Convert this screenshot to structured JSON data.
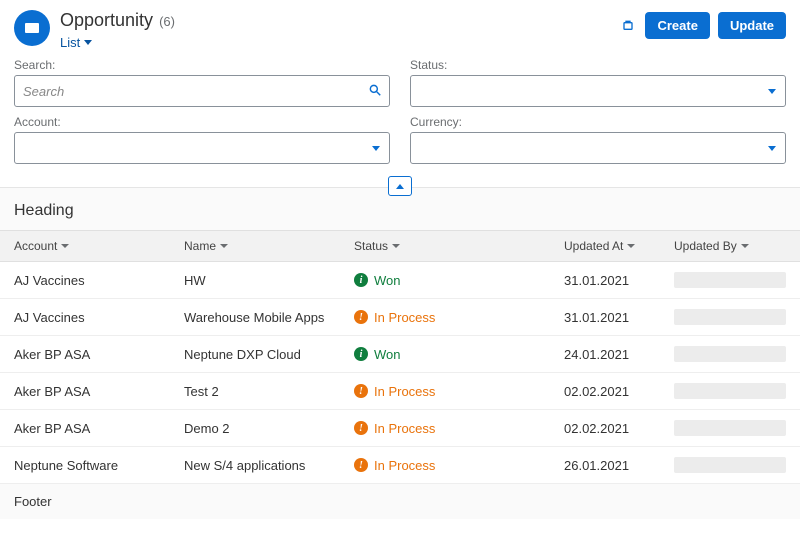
{
  "header": {
    "title": "Opportunity",
    "count": "(6)",
    "view": "List",
    "create_label": "Create",
    "update_label": "Update"
  },
  "filters": {
    "search_label": "Search:",
    "search_placeholder": "Search",
    "status_label": "Status:",
    "account_label": "Account:",
    "currency_label": "Currency:"
  },
  "table": {
    "heading": "Heading",
    "columns": {
      "account": "Account",
      "name": "Name",
      "status": "Status",
      "updated_at": "Updated At",
      "updated_by": "Updated By"
    },
    "rows": [
      {
        "account": "AJ Vaccines",
        "name": "HW",
        "status_text": "Won",
        "status_kind": "won",
        "updated_at": "31.01.2021"
      },
      {
        "account": "AJ Vaccines",
        "name": "Warehouse Mobile Apps",
        "status_text": "In Process",
        "status_kind": "inprocess",
        "updated_at": "31.01.2021"
      },
      {
        "account": "Aker BP ASA",
        "name": "Neptune DXP Cloud",
        "status_text": "Won",
        "status_kind": "won",
        "updated_at": "24.01.2021"
      },
      {
        "account": "Aker BP ASA",
        "name": "Test 2",
        "status_text": "In Process",
        "status_kind": "inprocess",
        "updated_at": "02.02.2021"
      },
      {
        "account": "Aker BP ASA",
        "name": "Demo 2",
        "status_text": "In Process",
        "status_kind": "inprocess",
        "updated_at": "02.02.2021"
      },
      {
        "account": "Neptune Software",
        "name": "New S/4 applications",
        "status_text": "In Process",
        "status_kind": "inprocess",
        "updated_at": "26.01.2021"
      }
    ],
    "footer": "Footer"
  }
}
